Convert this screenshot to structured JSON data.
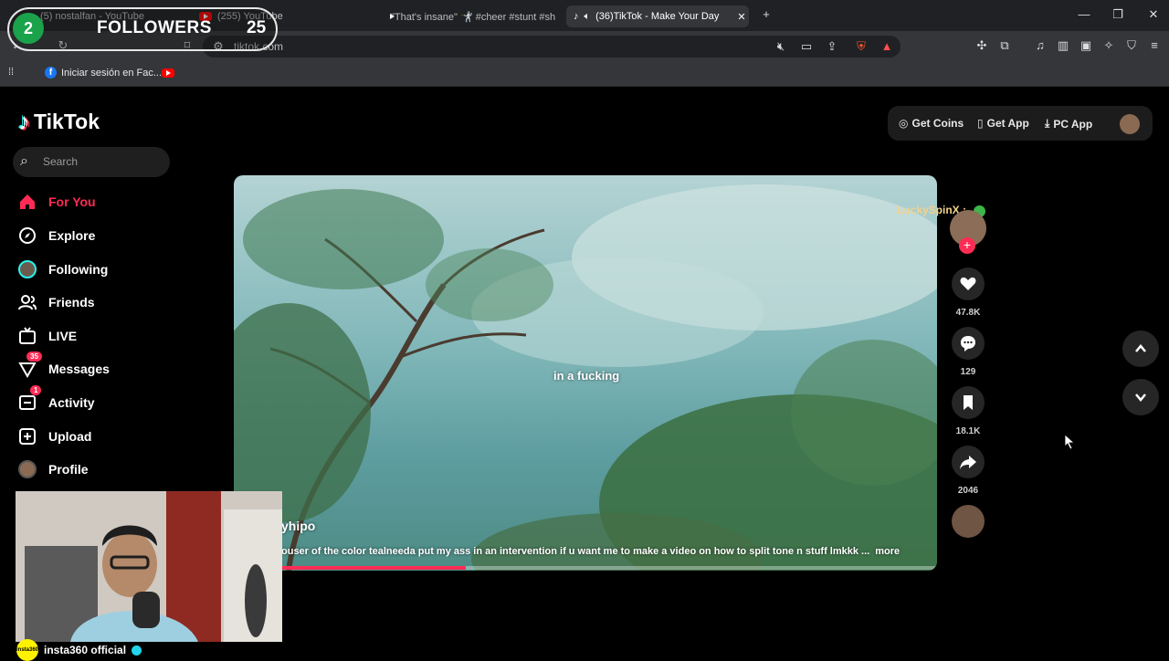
{
  "browser": {
    "tabs": [
      {
        "label": "(5) nostalfan - YouTube",
        "icon": "youtube-icon"
      },
      {
        "label": "(255) YouTube",
        "icon": "youtube-icon"
      },
      {
        "label": "\"That's insane\" 🤺 #cheer #stunt #sh",
        "icon": "youtube-icon"
      },
      {
        "label": "(36)TikTok - Make Your Day",
        "icon": "tiktok-icon",
        "active": true
      }
    ],
    "new_tab": "+",
    "window_controls": {
      "minimize": "—",
      "maximize": "❐",
      "close": "✕"
    },
    "url": "tiktok.com",
    "bookmarks": [
      {
        "label": "Iniciar sesión en Fac...",
        "icon": "facebook-icon"
      },
      {
        "label": "",
        "icon": "youtube-icon"
      }
    ]
  },
  "overlay": {
    "left_count": "2",
    "label": "FOLLOWERS",
    "count": "25"
  },
  "tiktok": {
    "brand": "TikTok",
    "search_placeholder": "Search",
    "nav": [
      {
        "label": "For You",
        "icon": "home-icon",
        "active": true
      },
      {
        "label": "Explore",
        "icon": "compass-icon"
      },
      {
        "label": "Following",
        "icon": "following-avatar-icon"
      },
      {
        "label": "Friends",
        "icon": "friends-icon"
      },
      {
        "label": "LIVE",
        "icon": "live-icon"
      },
      {
        "label": "Messages",
        "icon": "messages-icon",
        "badge": "35"
      },
      {
        "label": "Activity",
        "icon": "activity-icon",
        "badge": "1"
      },
      {
        "label": "Upload",
        "icon": "upload-icon"
      },
      {
        "label": "Profile",
        "icon": "profile-avatar-icon"
      }
    ],
    "top_actions": {
      "coins": "Get Coins",
      "app": "Get App",
      "pc_app": "PC App"
    },
    "video": {
      "caption_overlay": "in a fucking",
      "username": "yhipo",
      "description": "ouser of the color tealneeda put my ass in an intervention if u want me to make a video on how to split tone n stuff lmkkk ...",
      "more": "more",
      "progress": 0.33
    },
    "creator_comment": "LuckySpinX :",
    "actions": {
      "likes": "47.8K",
      "comments": "129",
      "saves": "18.1K",
      "shares": "2046"
    }
  },
  "webcam": {
    "channel": "insta360 official",
    "logo_text": "insta360"
  },
  "colors": {
    "accent": "#fe2c55",
    "cyan": "#25f4ee",
    "background": "#000000"
  }
}
